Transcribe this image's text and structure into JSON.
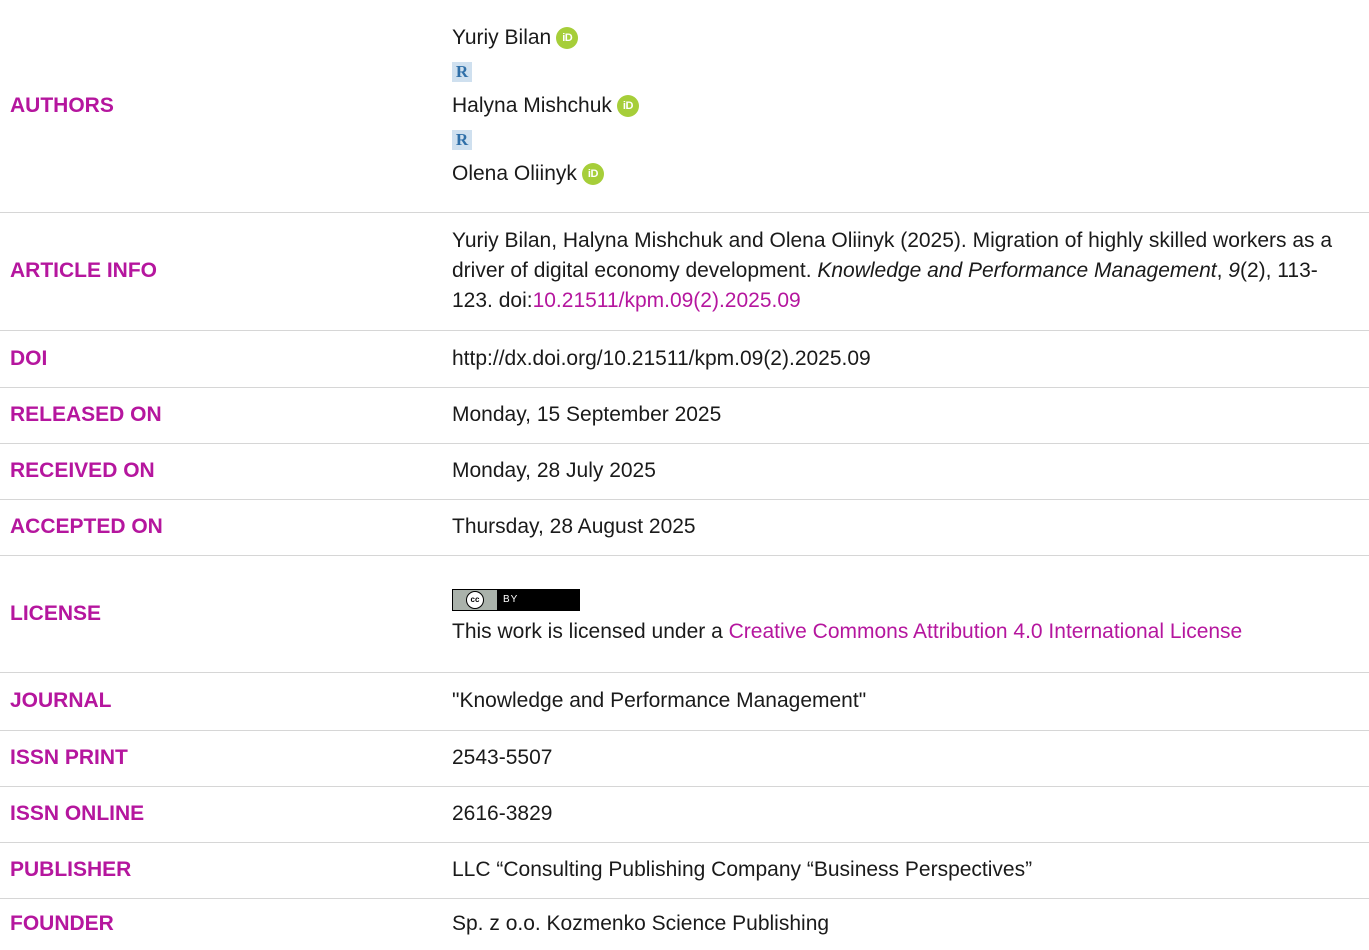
{
  "authors": {
    "label": "AUTHORS",
    "list": [
      {
        "name": "Yuriy Bilan",
        "orcid_icon": "orcid-icon",
        "has_rg": true
      },
      {
        "name": "Halyna Mishchuk",
        "orcid_icon": "orcid-icon",
        "has_rg": true
      },
      {
        "name": "Olena Oliinyk",
        "orcid_icon": "orcid-icon",
        "has_rg": false
      }
    ],
    "orcid_text": "iD",
    "rg_text": "R"
  },
  "article_info": {
    "label": "ARTICLE INFO",
    "citation_prefix": "Yuriy Bilan, Halyna Mishchuk and Olena Oliinyk (2025). Migration of highly skilled workers as a driver of digital economy development. ",
    "journal_italic": "Knowledge and Performance Management",
    "comma": ", ",
    "volume_italic": "9",
    "issue_pages": "(2), 113-123. doi:",
    "doi_link": "10.21511/kpm.09(2).2025.09"
  },
  "doi": {
    "label": "DOI",
    "value": "http://dx.doi.org/10.21511/kpm.09(2).2025.09"
  },
  "released_on": {
    "label": "RELEASED ON",
    "value": "Monday, 15 September 2025"
  },
  "received_on": {
    "label": "RECEIVED ON",
    "value": "Monday, 28 July 2025"
  },
  "accepted_on": {
    "label": "ACCEPTED ON",
    "value": "Thursday, 28 August 2025"
  },
  "license": {
    "label": "LICENSE",
    "badge_left": "cc",
    "badge_right": "BY",
    "text_prefix": "This work is licensed under a ",
    "link_text": "Creative Commons Attribution 4.0 International License"
  },
  "journal": {
    "label": "JOURNAL",
    "value": "\"Knowledge and Performance Management\""
  },
  "issn_print": {
    "label": "ISSN PRINT",
    "value": "2543-5507"
  },
  "issn_online": {
    "label": "ISSN ONLINE",
    "value": "2616-3829"
  },
  "publisher": {
    "label": "PUBLISHER",
    "value": "LLC “Consulting Publishing Company “Business Perspectives”"
  },
  "founder": {
    "label": "FOUNDER",
    "value": "Sp. z o.o. Kozmenko Science Publishing"
  },
  "colors": {
    "accent": "#b5169e",
    "orcid": "#a6ce39",
    "rule": "#d6d6d6"
  }
}
